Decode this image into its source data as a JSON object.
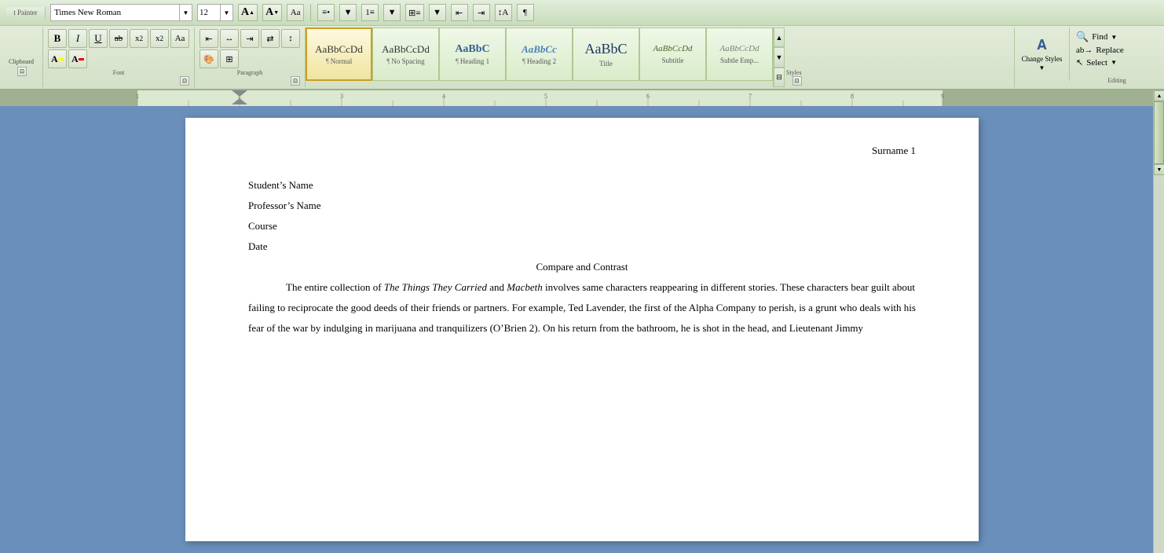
{
  "ribbon": {
    "font": {
      "name": "Times New Roman",
      "size": "12",
      "group_label": "Font"
    },
    "paragraph": {
      "group_label": "Paragraph"
    },
    "styles": {
      "group_label": "Styles",
      "items": [
        {
          "id": "normal",
          "preview": "AaBbCcDd",
          "label": "¶ Normal",
          "active": true
        },
        {
          "id": "nospace",
          "preview": "AaBbCcDd",
          "label": "¶ No Spacing",
          "active": false
        },
        {
          "id": "h1",
          "preview": "AaBbC",
          "label": "¶ Heading 1",
          "active": false
        },
        {
          "id": "h2",
          "preview": "AaBbCc",
          "label": "¶ Heading 2",
          "active": false
        },
        {
          "id": "title",
          "preview": "AaBbC",
          "label": "Title",
          "active": false
        },
        {
          "id": "subtitle",
          "preview": "AaBbCcD",
          "label": "Subtitle",
          "active": false
        },
        {
          "id": "subtle",
          "preview": "AaBbCcDd",
          "label": "Subtle Emp...",
          "active": false
        }
      ]
    },
    "change_styles_label": "Change\nStyles",
    "editing": {
      "label": "Editing",
      "find": "Find",
      "replace": "Replace",
      "select": "Select"
    }
  },
  "document": {
    "header_right": "Surname 1",
    "lines": [
      {
        "text": "Student’s Name",
        "type": "normal"
      },
      {
        "text": "Professor’s Name",
        "type": "normal"
      },
      {
        "text": "Course",
        "type": "normal"
      },
      {
        "text": "Date",
        "type": "normal"
      },
      {
        "text": "Compare and Contrast",
        "type": "center"
      },
      {
        "text": "",
        "type": "normal"
      },
      {
        "type": "body",
        "text": "The entire collection of The Things They Carried and Macbeth involves same characters reappearing in different stories. These characters bear guilt about failing to reciprocate the good deeds of their friends or partners. For example, Ted Lavender, the first of the Alpha Company to perish, is a grunt who deals with his fear of the war by indulging in marijuana and tranquilizers (O’Brien 2). On his return from the bathroom, he is shot in the head, and Lieutenant Jimmy"
      }
    ]
  },
  "toolbar": {
    "bold": "B",
    "italic": "I",
    "underline": "U",
    "strikethrough": "ab̲",
    "subscript": "x₂",
    "superscript": "x²",
    "font_color_label": "A",
    "highlight_label": "A",
    "find_icon": "&#128269;",
    "replace_icon": "ab→cd",
    "select_icon": ""
  }
}
